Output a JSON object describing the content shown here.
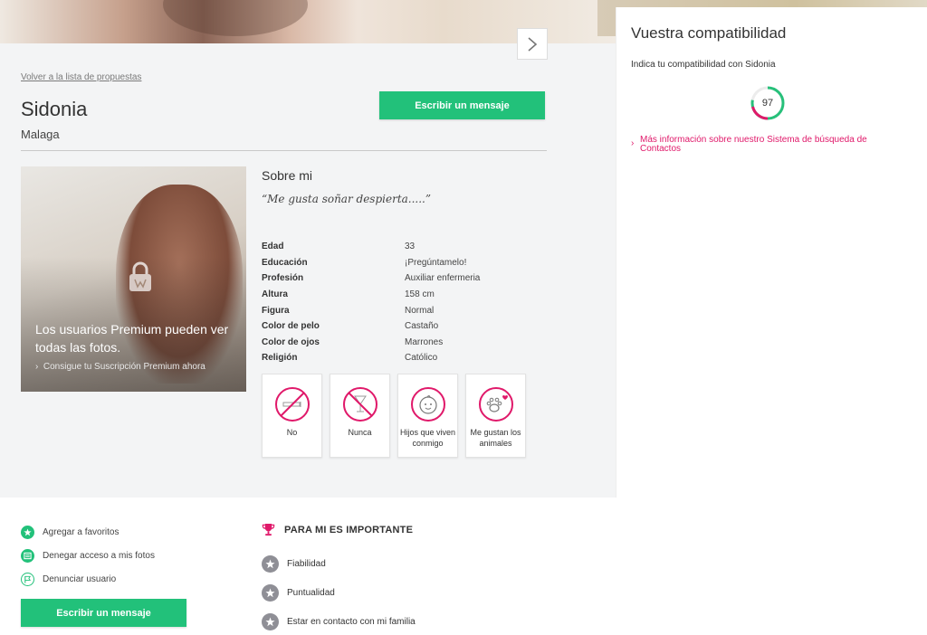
{
  "nav": {
    "back_link": "Volver a la lista de propuestas"
  },
  "profile": {
    "name": "Sidonia",
    "city": "Malaga",
    "write_message": "Escribir un mensaje"
  },
  "photo": {
    "locked_text": "Los usuarios Premium pueden ver todas las fotos.",
    "premium_link": "Consigue tu Suscripción Premium ahora"
  },
  "about": {
    "title": "Sobre mi",
    "quote": "“Me gusta soñar despierta.....”"
  },
  "details": [
    {
      "label": "Edad",
      "value": "33"
    },
    {
      "label": "Educación",
      "value": "¡Pregúntamelo!"
    },
    {
      "label": "Profesión",
      "value": "Auxiliar enfermeria"
    },
    {
      "label": "Altura",
      "value": "158 cm"
    },
    {
      "label": "Figura",
      "value": "Normal"
    },
    {
      "label": "Color de pelo",
      "value": "Castaño"
    },
    {
      "label": "Color de ojos",
      "value": "Marrones"
    },
    {
      "label": "Religión",
      "value": "Católico"
    }
  ],
  "habits": [
    {
      "icon": "no-smoking-icon",
      "label": "No"
    },
    {
      "icon": "no-drinking-icon",
      "label": "Nunca"
    },
    {
      "icon": "baby-face-icon",
      "label": "Hijos que viven conmigo"
    },
    {
      "icon": "paw-heart-icon",
      "label": "Me gustan los animales"
    }
  ],
  "compatibility": {
    "title": "Vuestra compatibilidad",
    "subtitle": "Indica tu compatibilidad con Sidonia",
    "score": "97",
    "score_value": 0.97,
    "info_link": "Más información sobre nuestro Sistema de búsqueda de Contactos"
  },
  "actions": [
    {
      "icon": "star-icon",
      "label": "Agregar a favoritos"
    },
    {
      "icon": "photo-lock-icon",
      "label": "Denegar acceso a mis fotos"
    },
    {
      "icon": "flag-icon",
      "label": "Denunciar usuario"
    }
  ],
  "important": {
    "title": "PARA MI ES IMPORTANTE",
    "items": [
      "Fiabilidad",
      "Puntualidad",
      "Estar en contacto con mi familia"
    ]
  },
  "colors": {
    "accent_green": "#22c17a",
    "accent_pink": "#e0196a",
    "gauge_green": "#27c07a"
  }
}
